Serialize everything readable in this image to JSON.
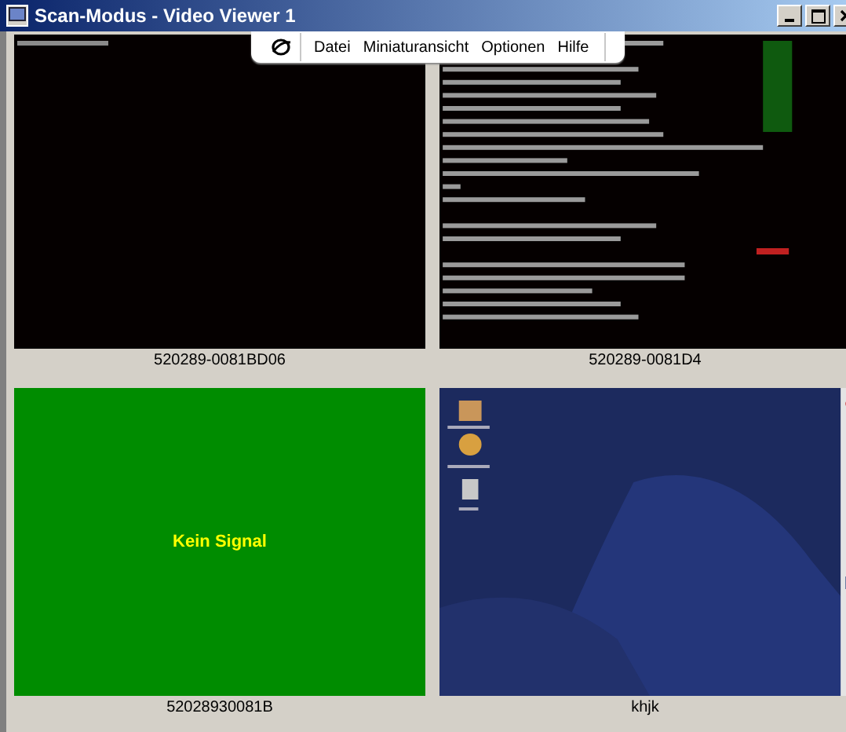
{
  "window": {
    "title": "Scan-Modus - Video Viewer 1"
  },
  "menu": {
    "items": [
      "Datei",
      "Miniaturansicht",
      "Optionen",
      "Hilfe"
    ]
  },
  "tiles": [
    {
      "kind": "terminal",
      "label": "520289-0081BD06"
    },
    {
      "kind": "terminal_log",
      "label": "520289-0081D4"
    },
    {
      "kind": "no_signal",
      "message": "Kein Signal",
      "label": "52028930081B"
    },
    {
      "kind": "desktop",
      "label": "khjk"
    }
  ]
}
